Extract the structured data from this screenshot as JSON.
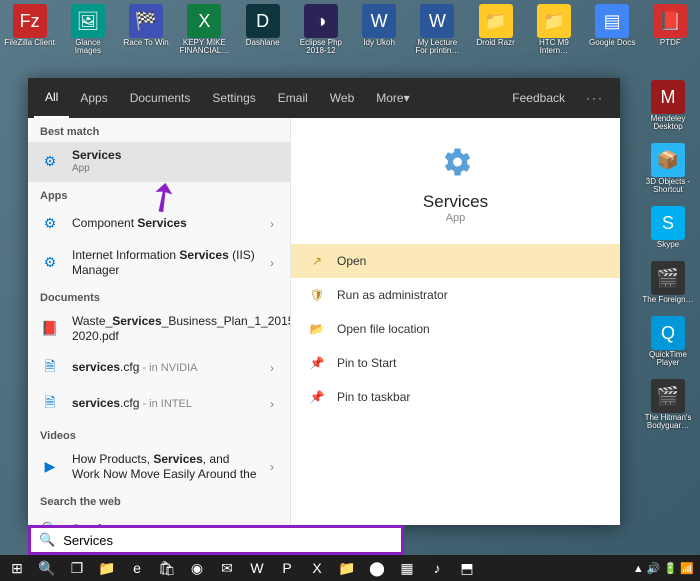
{
  "desktop_top": [
    {
      "name": "filezilla",
      "label": "FileZilla Client",
      "glyph": "Fz",
      "bg": "#c62828"
    },
    {
      "name": "glance",
      "label": "Glance Images",
      "glyph": "🖼",
      "bg": "#009688"
    },
    {
      "name": "race",
      "label": "Race To Win",
      "glyph": "🏁",
      "bg": "#3f51b5"
    },
    {
      "name": "kepy",
      "label": "KEPY MIKE FINANCIAL…",
      "glyph": "X",
      "bg": "#107c41"
    },
    {
      "name": "dashlane",
      "label": "Dashlane",
      "glyph": "D",
      "bg": "#0e353d"
    },
    {
      "name": "eclipse",
      "label": "Eclipse Php 2018-12",
      "glyph": "◑",
      "bg": "#2c2255"
    },
    {
      "name": "idy",
      "label": "Idy Ukoh",
      "glyph": "W",
      "bg": "#2b579a"
    },
    {
      "name": "lecture",
      "label": "My Lecture For printin…",
      "glyph": "W",
      "bg": "#2b579a"
    },
    {
      "name": "droid",
      "label": "Droid Razr",
      "glyph": "📁",
      "bg": "#ffca28"
    },
    {
      "name": "htc",
      "label": "HTC M9 Intern…",
      "glyph": "📁",
      "bg": "#ffca28"
    },
    {
      "name": "gdocs",
      "label": "Google Docs",
      "glyph": "▤",
      "bg": "#4285f4"
    },
    {
      "name": "ptdf",
      "label": "PTDF",
      "glyph": "📕",
      "bg": "#d32f2f"
    }
  ],
  "desktop_right": [
    {
      "name": "mendeley",
      "label": "Mendeley Desktop",
      "glyph": "M",
      "bg": "#9a1b1b"
    },
    {
      "name": "3dobjects",
      "label": "3D Objects - Shortcut",
      "glyph": "📦",
      "bg": "#29b6f6"
    },
    {
      "name": "skype",
      "label": "Skype",
      "glyph": "S",
      "bg": "#00aff0"
    },
    {
      "name": "foreign",
      "label": "The Foreign…",
      "glyph": "🎬",
      "bg": "#333"
    },
    {
      "name": "quicktime",
      "label": "QuickTime Player",
      "glyph": "Q",
      "bg": "#0098d8"
    },
    {
      "name": "hitman",
      "label": "The Hitman's Bodyguar…",
      "glyph": "🎬",
      "bg": "#333"
    }
  ],
  "tabs": {
    "all": "All",
    "apps": "Apps",
    "documents": "Documents",
    "settings": "Settings",
    "email": "Email",
    "web": "Web",
    "more": "More",
    "feedback": "Feedback"
  },
  "best_match_h": "Best match",
  "best_match": {
    "title": "Services",
    "sub": "App"
  },
  "apps_h": "Apps",
  "apps": [
    {
      "pre": "Component ",
      "bold": "Services",
      "post": ""
    },
    {
      "pre": "Internet Information ",
      "bold": "Services",
      "post": " (IIS) Manager"
    }
  ],
  "docs_h": "Documents",
  "docs": [
    {
      "pre": "Waste_",
      "bold": "Services",
      "post": "_Business_Plan_1_2015-2020.pdf"
    },
    {
      "pre": "",
      "bold": "services",
      "post": ".cfg",
      "loc": " - in NVIDIA"
    },
    {
      "pre": "",
      "bold": "services",
      "post": ".cfg",
      "loc": " - in INTEL"
    }
  ],
  "videos_h": "Videos",
  "videos": [
    {
      "pre": "How Products, ",
      "bold": "Services",
      "post": ", and Work Now Move Easily Around the"
    }
  ],
  "web_h": "Search the web",
  "web_item": {
    "pre": "",
    "bold": "Services",
    "post": "",
    "loc": " - See web results"
  },
  "right_pane": {
    "title": "Services",
    "sub": "App"
  },
  "actions": [
    {
      "label": "Open",
      "icon": "↗",
      "sel": true
    },
    {
      "label": "Run as administrator",
      "icon": "🛡",
      "sel": false
    },
    {
      "label": "Open file location",
      "icon": "📂",
      "sel": false
    },
    {
      "label": "Pin to Start",
      "icon": "📌",
      "sel": false
    },
    {
      "label": "Pin to taskbar",
      "icon": "📌",
      "sel": false
    }
  ],
  "search_value": "Services",
  "taskbar": [
    {
      "name": "start",
      "glyph": "⊞"
    },
    {
      "name": "search",
      "glyph": "🔍"
    },
    {
      "name": "task-view",
      "glyph": "❐"
    },
    {
      "name": "explorer",
      "glyph": "📁"
    },
    {
      "name": "edge",
      "glyph": "e"
    },
    {
      "name": "store",
      "glyph": "🛍"
    },
    {
      "name": "chrome",
      "glyph": "◉"
    },
    {
      "name": "outlook",
      "glyph": "✉"
    },
    {
      "name": "word",
      "glyph": "W"
    },
    {
      "name": "powerpoint",
      "glyph": "P"
    },
    {
      "name": "excel",
      "glyph": "X"
    },
    {
      "name": "folder2",
      "glyph": "📁"
    },
    {
      "name": "app1",
      "glyph": "⬤"
    },
    {
      "name": "app2",
      "glyph": "▦"
    },
    {
      "name": "app3",
      "glyph": "♪"
    },
    {
      "name": "app4",
      "glyph": "⬒"
    }
  ]
}
